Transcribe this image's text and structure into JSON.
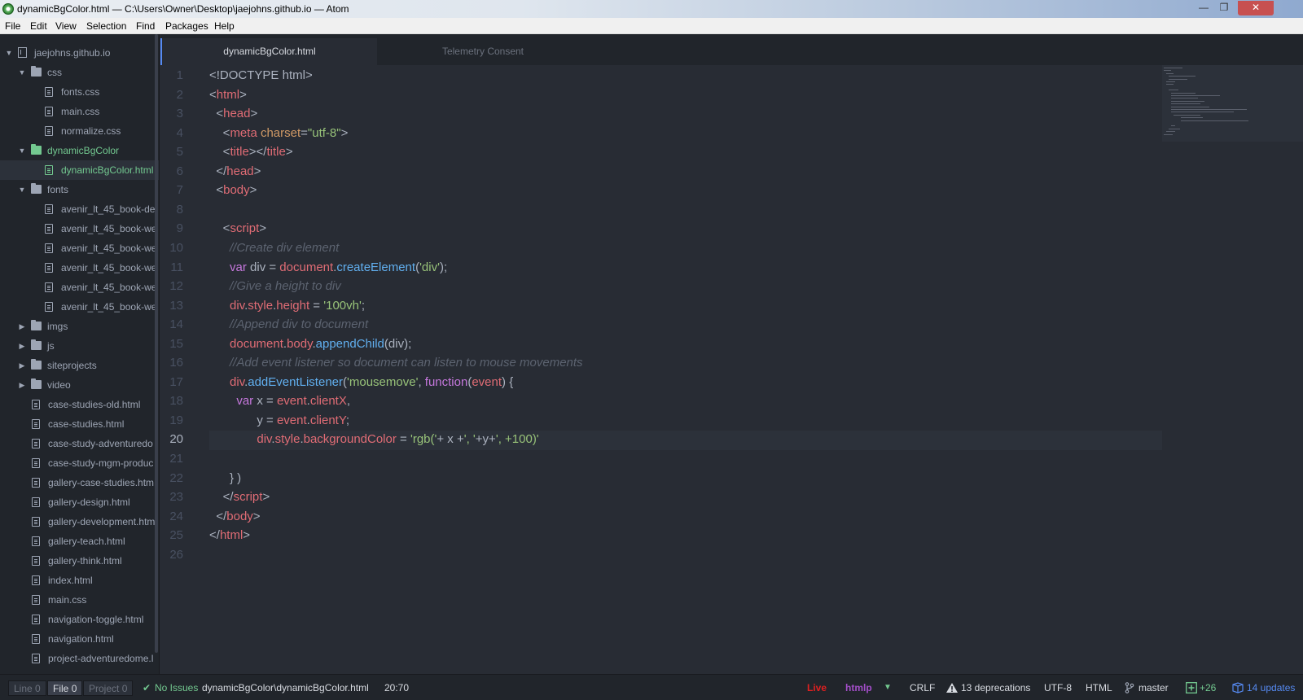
{
  "window": {
    "title": "dynamicBgColor.html — C:\\Users\\Owner\\Desktop\\jaejohns.github.io — Atom",
    "minimize": "—",
    "restore": "❐",
    "close": "✕"
  },
  "menu": [
    "File",
    "Edit",
    "View",
    "Selection",
    "Find",
    "Packages",
    "Help"
  ],
  "tree": [
    {
      "label": "jaejohns.github.io",
      "kind": "repo",
      "depth": 0,
      "expanded": true
    },
    {
      "label": "css",
      "kind": "folder",
      "depth": 1,
      "expanded": true
    },
    {
      "label": "fonts.css",
      "kind": "file",
      "depth": 2
    },
    {
      "label": "main.css",
      "kind": "file",
      "depth": 2
    },
    {
      "label": "normalize.css",
      "kind": "file",
      "depth": 2
    },
    {
      "label": "dynamicBgColor",
      "kind": "folder",
      "depth": 1,
      "expanded": true,
      "active": true
    },
    {
      "label": "dynamicBgColor.html",
      "kind": "file",
      "depth": 2,
      "active": true,
      "selected": true
    },
    {
      "label": "fonts",
      "kind": "folder",
      "depth": 1,
      "expanded": true
    },
    {
      "label": "avenir_lt_45_book-de",
      "kind": "file",
      "depth": 2
    },
    {
      "label": "avenir_lt_45_book-we",
      "kind": "file",
      "depth": 2
    },
    {
      "label": "avenir_lt_45_book-we",
      "kind": "file",
      "depth": 2
    },
    {
      "label": "avenir_lt_45_book-we",
      "kind": "file",
      "depth": 2
    },
    {
      "label": "avenir_lt_45_book-we",
      "kind": "file",
      "depth": 2
    },
    {
      "label": "avenir_lt_45_book-we",
      "kind": "file",
      "depth": 2
    },
    {
      "label": "imgs",
      "kind": "folder",
      "depth": 1,
      "expanded": false
    },
    {
      "label": "js",
      "kind": "folder",
      "depth": 1,
      "expanded": false
    },
    {
      "label": "siteprojects",
      "kind": "folder",
      "depth": 1,
      "expanded": false
    },
    {
      "label": "video",
      "kind": "folder",
      "depth": 1,
      "expanded": false
    },
    {
      "label": "case-studies-old.html",
      "kind": "file",
      "depth": 1
    },
    {
      "label": "case-studies.html",
      "kind": "file",
      "depth": 1
    },
    {
      "label": "case-study-adventuredo",
      "kind": "file",
      "depth": 1
    },
    {
      "label": "case-study-mgm-produc",
      "kind": "file",
      "depth": 1
    },
    {
      "label": "gallery-case-studies.htm",
      "kind": "file",
      "depth": 1
    },
    {
      "label": "gallery-design.html",
      "kind": "file",
      "depth": 1
    },
    {
      "label": "gallery-development.htm",
      "kind": "file",
      "depth": 1
    },
    {
      "label": "gallery-teach.html",
      "kind": "file",
      "depth": 1
    },
    {
      "label": "gallery-think.html",
      "kind": "file",
      "depth": 1
    },
    {
      "label": "index.html",
      "kind": "file",
      "depth": 1
    },
    {
      "label": "main.css",
      "kind": "file",
      "depth": 1
    },
    {
      "label": "navigation-toggle.html",
      "kind": "file",
      "depth": 1
    },
    {
      "label": "navigation.html",
      "kind": "file",
      "depth": 1
    },
    {
      "label": "project-adventuredome.l",
      "kind": "file",
      "depth": 1
    }
  ],
  "tabs": [
    {
      "label": "dynamicBgColor.html",
      "active": true
    },
    {
      "label": "Telemetry Consent",
      "active": false
    }
  ],
  "editor": {
    "current_line": 20,
    "lines": [
      [
        [
          "<!DOCTYPE html>",
          "punct"
        ]
      ],
      [
        [
          "<",
          "punct"
        ],
        [
          "html",
          "tag"
        ],
        [
          ">",
          "punct"
        ]
      ],
      [
        [
          "  <",
          "punct"
        ],
        [
          "head",
          "tag"
        ],
        [
          ">",
          "punct"
        ]
      ],
      [
        [
          "    <",
          "punct"
        ],
        [
          "meta",
          "tag"
        ],
        [
          " charset",
          "attr"
        ],
        [
          "=",
          "punct"
        ],
        [
          "\"utf-8\"",
          "str"
        ],
        [
          ">",
          "punct"
        ]
      ],
      [
        [
          "    <",
          "punct"
        ],
        [
          "title",
          "tag"
        ],
        [
          "></",
          "punct"
        ],
        [
          "title",
          "tag"
        ],
        [
          ">",
          "punct"
        ]
      ],
      [
        [
          "  </",
          "punct"
        ],
        [
          "head",
          "tag"
        ],
        [
          ">",
          "punct"
        ]
      ],
      [
        [
          "  <",
          "punct"
        ],
        [
          "body",
          "tag"
        ],
        [
          ">",
          "punct"
        ]
      ],
      [],
      [
        [
          "    <",
          "punct"
        ],
        [
          "script",
          "tag"
        ],
        [
          ">",
          "punct"
        ]
      ],
      [
        [
          "      //Create div element",
          "comment"
        ]
      ],
      [
        [
          "      ",
          "plain"
        ],
        [
          "var",
          "kw"
        ],
        [
          " div = ",
          "plain"
        ],
        [
          "document",
          "var"
        ],
        [
          ".",
          "plain"
        ],
        [
          "createElement",
          "fn"
        ],
        [
          "(",
          "plain"
        ],
        [
          "'div'",
          "str"
        ],
        [
          ");",
          "plain"
        ]
      ],
      [
        [
          "      //Give a height to div",
          "comment"
        ]
      ],
      [
        [
          "      ",
          "plain"
        ],
        [
          "div",
          "var"
        ],
        [
          ".",
          "plain"
        ],
        [
          "style",
          "var"
        ],
        [
          ".",
          "plain"
        ],
        [
          "height",
          "var"
        ],
        [
          " = ",
          "plain"
        ],
        [
          "'100vh'",
          "str"
        ],
        [
          ";",
          "plain"
        ]
      ],
      [
        [
          "      //Append div to document",
          "comment"
        ]
      ],
      [
        [
          "      ",
          "plain"
        ],
        [
          "document",
          "var"
        ],
        [
          ".",
          "plain"
        ],
        [
          "body",
          "var"
        ],
        [
          ".",
          "plain"
        ],
        [
          "appendChild",
          "fn"
        ],
        [
          "(div);",
          "plain"
        ]
      ],
      [
        [
          "      //Add event listener so document can listen to mouse movements",
          "comment"
        ]
      ],
      [
        [
          "      ",
          "plain"
        ],
        [
          "div",
          "var"
        ],
        [
          ".",
          "plain"
        ],
        [
          "addEventListener",
          "fn"
        ],
        [
          "(",
          "plain"
        ],
        [
          "'mousemove'",
          "str"
        ],
        [
          ", ",
          "plain"
        ],
        [
          "function",
          "kw"
        ],
        [
          "(",
          "plain"
        ],
        [
          "event",
          "param"
        ],
        [
          ") {",
          "plain"
        ]
      ],
      [
        [
          "        ",
          "plain"
        ],
        [
          "var",
          "kw"
        ],
        [
          " x = ",
          "plain"
        ],
        [
          "event",
          "var"
        ],
        [
          ".",
          "plain"
        ],
        [
          "clientX",
          "var"
        ],
        [
          ",",
          "plain"
        ]
      ],
      [
        [
          "              y = ",
          "plain"
        ],
        [
          "event",
          "var"
        ],
        [
          ".",
          "plain"
        ],
        [
          "clientY",
          "var"
        ],
        [
          ";",
          "plain"
        ]
      ],
      [
        [
          "              ",
          "plain"
        ],
        [
          "div",
          "var"
        ],
        [
          ".",
          "plain"
        ],
        [
          "style",
          "var"
        ],
        [
          ".",
          "plain"
        ],
        [
          "backgroundColor",
          "var"
        ],
        [
          " = ",
          "plain"
        ],
        [
          "'rgb('",
          "str"
        ],
        [
          "+ x +",
          "plain"
        ],
        [
          "', '",
          "str"
        ],
        [
          "+y+",
          "plain"
        ],
        [
          "', +100)'",
          "str"
        ]
      ],
      [],
      [
        [
          "      } )",
          "plain"
        ]
      ],
      [
        [
          "    </",
          "punct"
        ],
        [
          "script",
          "tag"
        ],
        [
          ">",
          "punct"
        ]
      ],
      [
        [
          "  </",
          "punct"
        ],
        [
          "body",
          "tag"
        ],
        [
          ">",
          "punct"
        ]
      ],
      [
        [
          "</",
          "punct"
        ],
        [
          "html",
          "tag"
        ],
        [
          ">",
          "punct"
        ]
      ],
      []
    ]
  },
  "status": {
    "find_tabs": [
      {
        "label": "Line",
        "count": "0"
      },
      {
        "label": "File",
        "count": "0",
        "selected": true
      },
      {
        "label": "Project",
        "count": "0"
      }
    ],
    "issues_icon": "✔",
    "issues": "No Issues",
    "path": "dynamicBgColor\\dynamicBgColor.html",
    "cursor": "20:70",
    "live": "Live",
    "grammar_plugin": "htmlp",
    "grammar_arrow": "▼",
    "line_ending": "CRLF",
    "deprecations": "13 deprecations",
    "encoding": "UTF-8",
    "grammar": "HTML",
    "branch": "master",
    "diff": "+26",
    "updates": "14 updates"
  },
  "colors": {
    "accent": "#568af2",
    "added": "#73c990",
    "live": "#e02020",
    "plugin": "#a34ec9"
  }
}
